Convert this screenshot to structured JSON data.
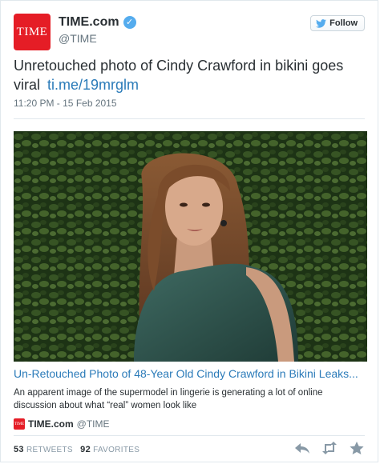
{
  "account": {
    "display_name": "TIME.com",
    "screen_name": "@TIME",
    "avatar_text": "TIME",
    "follow_label": "Follow"
  },
  "tweet": {
    "text": "Unretouched photo of Cindy Crawford in bikini goes viral",
    "link": "ti.me/19mrglm",
    "timestamp": "11:20 PM - 15 Feb 2015"
  },
  "card": {
    "title": "Un-Retouched Photo of 48-Year Old Cindy Crawford in Bikini Leaks...",
    "description": "An apparent image of the supermodel in lingerie is generating a lot of online discussion about what “real” women look like",
    "site": "TIME.com",
    "handle": "@TIME",
    "mini_logo_text": "TIME"
  },
  "stats": {
    "retweets": "53",
    "retweets_label": "RETWEETS",
    "favorites": "92",
    "favorites_label": "FAVORITES"
  },
  "colors": {
    "brand_red": "#e51d26",
    "link_blue": "#2b7bb9",
    "verified_blue": "#55acee"
  },
  "icons": [
    "verified-icon",
    "twitter-bird-icon",
    "reply-icon",
    "retweet-icon",
    "favorite-icon"
  ]
}
